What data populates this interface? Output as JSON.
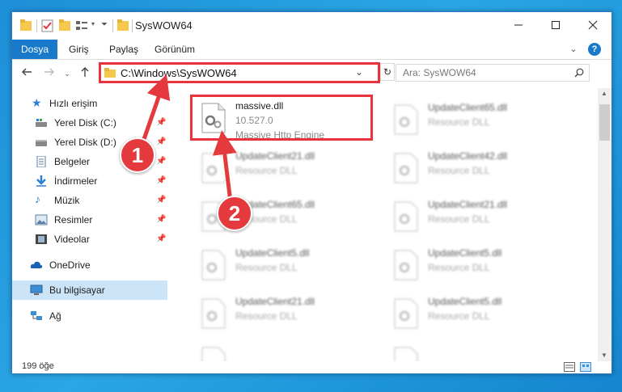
{
  "window": {
    "title": "SysWOW64"
  },
  "ribbon": {
    "tabs": [
      {
        "label": "Dosya"
      },
      {
        "label": "Giriş"
      },
      {
        "label": "Paylaş"
      },
      {
        "label": "Görünüm"
      }
    ]
  },
  "address": {
    "path": "C:\\Windows\\SysWOW64"
  },
  "search": {
    "placeholder": "Ara: SysWOW64"
  },
  "sidebar": {
    "items": [
      {
        "label": "Hızlı erişim",
        "icon": "star-icon"
      },
      {
        "label": "Yerel Disk (C:)",
        "icon": "disk-icon",
        "pinned": true
      },
      {
        "label": "Yerel Disk (D:)",
        "icon": "disk-icon",
        "pinned": true
      },
      {
        "label": "Belgeler",
        "icon": "documents-icon",
        "pinned": true
      },
      {
        "label": "İndirmeler",
        "icon": "download-icon",
        "pinned": true
      },
      {
        "label": "Müzik",
        "icon": "music-icon",
        "pinned": true
      },
      {
        "label": "Resimler",
        "icon": "pictures-icon",
        "pinned": true
      },
      {
        "label": "Videolar",
        "icon": "videos-icon",
        "pinned": true
      },
      {
        "label": "OneDrive",
        "icon": "cloud-icon"
      },
      {
        "label": "Bu bilgisayar",
        "icon": "computer-icon",
        "selected": true
      },
      {
        "label": "Ağ",
        "icon": "network-icon"
      }
    ]
  },
  "files": {
    "highlighted": {
      "name": "massive.dll",
      "version": "10.527.0",
      "description": "Massive Http Engine"
    },
    "items": [
      {
        "name": "UpdateClient65.dll",
        "type": "Resource DLL"
      },
      {
        "name": "UpdateClient21.dll",
        "type": "Resource DLL"
      },
      {
        "name": "UpdateClient42.dll",
        "type": "Resource DLL"
      },
      {
        "name": "UpdateClient65.dll",
        "type": "Resource DLL"
      },
      {
        "name": "UpdateClient21.dll",
        "type": "Resource DLL"
      },
      {
        "name": "UpdateClient5.dll",
        "type": "Resource DLL"
      },
      {
        "name": "UpdateClient5.dll",
        "type": "Resource DLL"
      },
      {
        "name": "UpdateClient21.dll",
        "type": "Resource DLL"
      },
      {
        "name": "UpdateClient5.dll",
        "type": "Resource DLL"
      }
    ]
  },
  "status": {
    "count": "199 öğe"
  },
  "annotations": {
    "badge1": "1",
    "badge2": "2"
  },
  "colors": {
    "accent": "#1979ca",
    "highlight": "#e8323c",
    "selection": "#cce4f7"
  }
}
